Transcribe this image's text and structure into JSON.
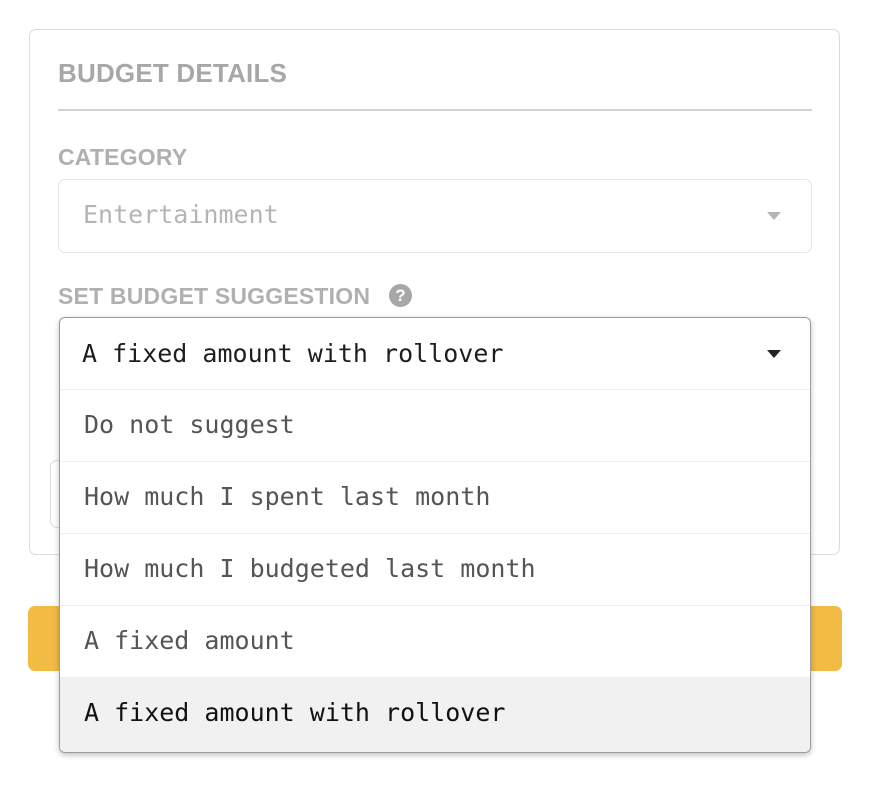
{
  "panel": {
    "title": "BUDGET DETAILS"
  },
  "category": {
    "label": "CATEGORY",
    "value": "Entertainment"
  },
  "suggestion": {
    "label": "SET BUDGET SUGGESTION",
    "help_glyph": "?",
    "selected": "A fixed amount with rollover",
    "options": [
      {
        "label": "Do not suggest"
      },
      {
        "label": "How much I spent last month"
      },
      {
        "label": "How much I budgeted last month"
      },
      {
        "label": "A fixed amount"
      },
      {
        "label": "A fixed amount with rollover"
      }
    ]
  },
  "colors": {
    "label_gray": "#a7a7a7",
    "button_yellow": "#f2bb43",
    "highlight": "#f1f1f1"
  },
  "icons": {
    "dropdown_caret": "chevron-down-icon",
    "help": "help-circle-icon"
  }
}
